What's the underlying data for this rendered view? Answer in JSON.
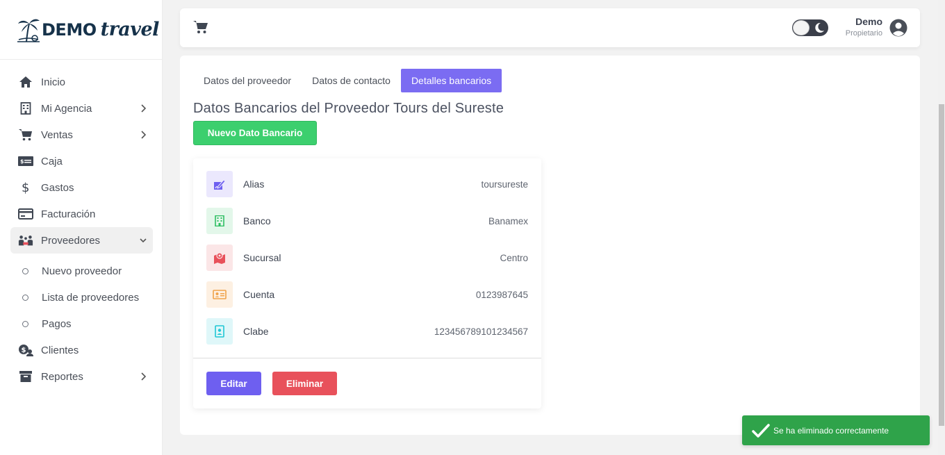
{
  "brand": {
    "demo": "DEMO",
    "travel": "travel"
  },
  "sidebar": {
    "items": [
      {
        "label": "Inicio",
        "icon": "home-icon"
      },
      {
        "label": "Mi Agencia",
        "icon": "building-icon"
      },
      {
        "label": "Ventas",
        "icon": "cart-icon"
      },
      {
        "label": "Caja",
        "icon": "cash-icon"
      },
      {
        "label": "Gastos",
        "icon": "dollar-icon"
      },
      {
        "label": "Facturación",
        "icon": "credit-card-icon"
      },
      {
        "label": "Proveedores",
        "icon": "people-icon"
      },
      {
        "label": "Clientes",
        "icon": "client-money-icon"
      },
      {
        "label": "Reportes",
        "icon": "archive-icon"
      }
    ],
    "sub_items": [
      {
        "label": "Nuevo proveedor"
      },
      {
        "label": "Lista de proveedores"
      },
      {
        "label": "Pagos"
      }
    ]
  },
  "topbar": {
    "user_name": "Demo",
    "user_role": "Propietario"
  },
  "main": {
    "tabs": [
      {
        "label": "Datos del proveedor"
      },
      {
        "label": "Datos de contacto"
      },
      {
        "label": "Detalles bancarios"
      }
    ],
    "title": "Datos Bancarios del Proveedor Tours del Sureste",
    "new_button": "Nuevo Dato Bancario",
    "fields": [
      {
        "label": "Alias",
        "value": "toursureste",
        "icon": "edit-signature-icon",
        "color": "#6e5ff0",
        "bg": "#ebe8fd"
      },
      {
        "label": "Banco",
        "value": "Banamex",
        "icon": "building-icon",
        "color": "#2fbf63",
        "bg": "#e3f7ea"
      },
      {
        "label": "Sucursal",
        "value": "Centro",
        "icon": "map-marker-icon",
        "color": "#e8515b",
        "bg": "#fbe6e7"
      },
      {
        "label": "Cuenta",
        "value": "0123987645",
        "icon": "id-card-icon",
        "color": "#f0a24a",
        "bg": "#fdf0e2"
      },
      {
        "label": "Clabe",
        "value": "123456789101234567",
        "icon": "id-badge-icon",
        "color": "#1fc7d4",
        "bg": "#dff7f9"
      }
    ],
    "edit_button": "Editar",
    "delete_button": "Eliminar"
  },
  "toast": {
    "message": "Se ha eliminado correctamente"
  }
}
